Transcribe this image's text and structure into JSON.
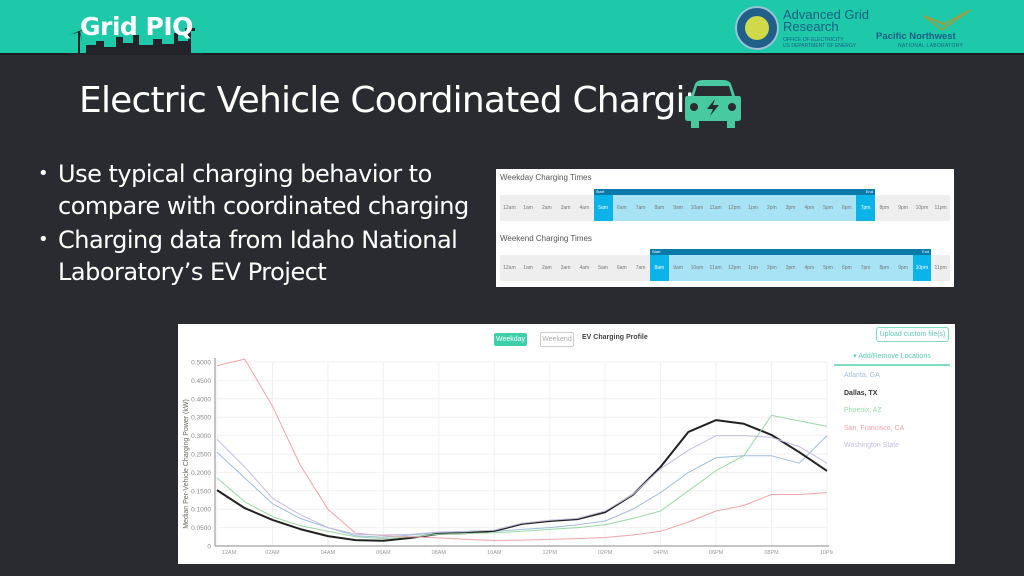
{
  "header": {
    "brand": "Grid PIQ",
    "agr": {
      "title_line1": "Advanced Grid",
      "title_line2": "Research",
      "sub_line1": "OFFICE OF ELECTRICITY",
      "sub_line2": "US DEPARTMENT OF ENERGY"
    },
    "pnnl": {
      "title": "Pacific Northwest",
      "sub": "NATIONAL LABORATORY"
    },
    "colors": {
      "bar": "#1dc9a8",
      "background": "#2a2b30"
    }
  },
  "slide": {
    "title": "Electric Vehicle Coordinated Charging",
    "icon": "ev-car-charging-icon",
    "bullets": [
      "Use typical charging behavior to compare with coordinated charging",
      "Charging data from Idaho National Laboratory’s EV Project"
    ]
  },
  "charging_times": {
    "weekday": {
      "label": "Weekday Charging Times",
      "start_label": "Start",
      "end_label": "End",
      "hours": [
        "12am",
        "1am",
        "2am",
        "3am",
        "4am",
        "5am",
        "6am",
        "7am",
        "8am",
        "9am",
        "10am",
        "11am",
        "12pm",
        "1pm",
        "2pm",
        "3pm",
        "4pm",
        "5pm",
        "6pm",
        "7pm",
        "8pm",
        "9pm",
        "10pm",
        "11pm"
      ],
      "start": "5am",
      "end": "7pm"
    },
    "weekend": {
      "label": "Weekend Charging Times",
      "start_label": "Start",
      "end_label": "End",
      "hours": [
        "12am",
        "1am",
        "2am",
        "3am",
        "4am",
        "5am",
        "6am",
        "7am",
        "8am",
        "9am",
        "10am",
        "11am",
        "12pm",
        "1pm",
        "2pm",
        "3pm",
        "4pm",
        "5pm",
        "6pm",
        "7pm",
        "8pm",
        "9pm",
        "10pm",
        "11pm"
      ],
      "start": "8am",
      "end": "10pm"
    }
  },
  "profile": {
    "weekday_button": "Weekday",
    "weekend_button": "Weekend",
    "title": "EV Charging Profile",
    "upload_button": "Upload custom file(s)",
    "locations_toggle": "▾ Add/Remove Locations",
    "locations": [
      {
        "name": "Atlanta, GA",
        "color": "#9fbddb",
        "active": false
      },
      {
        "name": "Dallas, TX",
        "color": "#333333",
        "active": true
      },
      {
        "name": "Phoenix, AZ",
        "color": "#98d9a3",
        "active": false
      },
      {
        "name": "San, Francisco, CA",
        "color": "#f0a4aa",
        "active": false
      },
      {
        "name": "Washington State",
        "color": "#c2bde0",
        "active": false
      }
    ]
  },
  "chart_data": {
    "type": "line",
    "title": "EV Charging Profile",
    "xlabel": "",
    "ylabel": "Median Per-Vehicle Charging Power (kW)",
    "ylim": [
      0,
      0.5
    ],
    "yticks": [
      "0",
      "0.0500",
      "0.1000",
      "0.1500",
      "0.2000",
      "0.2500",
      "0.3000",
      "0.3500",
      "0.4000",
      "0.4500",
      "0.5000"
    ],
    "ytick_values": [
      0,
      0.05,
      0.1,
      0.15,
      0.2,
      0.25,
      0.3,
      0.35,
      0.4,
      0.45,
      0.5
    ],
    "xticks": [
      "12AM",
      "02AM",
      "04AM",
      "06AM",
      "08AM",
      "10AM",
      "12PM",
      "02PM",
      "04PM",
      "06PM",
      "08PM",
      "10PM"
    ],
    "x_hours": [
      0,
      1,
      2,
      3,
      4,
      5,
      6,
      7,
      8,
      9,
      10,
      11,
      12,
      13,
      14,
      15,
      16,
      17,
      18,
      19,
      20,
      21,
      22
    ],
    "grid": true,
    "legend": "right",
    "series": [
      {
        "name": "Atlanta, GA",
        "color": "#9fbddb",
        "width": 1,
        "values": [
          0.255,
          0.185,
          0.115,
          0.075,
          0.05,
          0.028,
          0.024,
          0.03,
          0.036,
          0.038,
          0.04,
          0.045,
          0.05,
          0.058,
          0.068,
          0.1,
          0.145,
          0.2,
          0.24,
          0.245,
          0.245,
          0.225,
          0.3
        ]
      },
      {
        "name": "Dallas, TX",
        "color": "#222222",
        "width": 2,
        "values": [
          0.152,
          0.103,
          0.071,
          0.046,
          0.027,
          0.016,
          0.014,
          0.022,
          0.033,
          0.035,
          0.041,
          0.06,
          0.068,
          0.073,
          0.092,
          0.139,
          0.215,
          0.31,
          0.342,
          0.332,
          0.302,
          0.255,
          0.204
        ]
      },
      {
        "name": "Phoenix, AZ",
        "color": "#98d9a3",
        "width": 1,
        "values": [
          0.185,
          0.12,
          0.08,
          0.055,
          0.04,
          0.025,
          0.02,
          0.025,
          0.032,
          0.034,
          0.036,
          0.04,
          0.045,
          0.05,
          0.058,
          0.075,
          0.095,
          0.15,
          0.205,
          0.245,
          0.355,
          0.34,
          0.325
        ]
      },
      {
        "name": "San, Francisco, CA",
        "color": "#f0a4aa",
        "width": 1,
        "values": [
          0.49,
          0.508,
          0.38,
          0.22,
          0.1,
          0.035,
          0.028,
          0.025,
          0.022,
          0.018,
          0.015,
          0.016,
          0.018,
          0.02,
          0.023,
          0.03,
          0.04,
          0.065,
          0.095,
          0.11,
          0.14,
          0.14,
          0.145
        ]
      },
      {
        "name": "Washington State",
        "color": "#c2bde0",
        "width": 1,
        "values": [
          0.29,
          0.215,
          0.13,
          0.085,
          0.05,
          0.032,
          0.03,
          0.032,
          0.038,
          0.04,
          0.043,
          0.062,
          0.07,
          0.075,
          0.095,
          0.14,
          0.21,
          0.26,
          0.3,
          0.3,
          0.295,
          0.27,
          0.225
        ]
      }
    ]
  }
}
